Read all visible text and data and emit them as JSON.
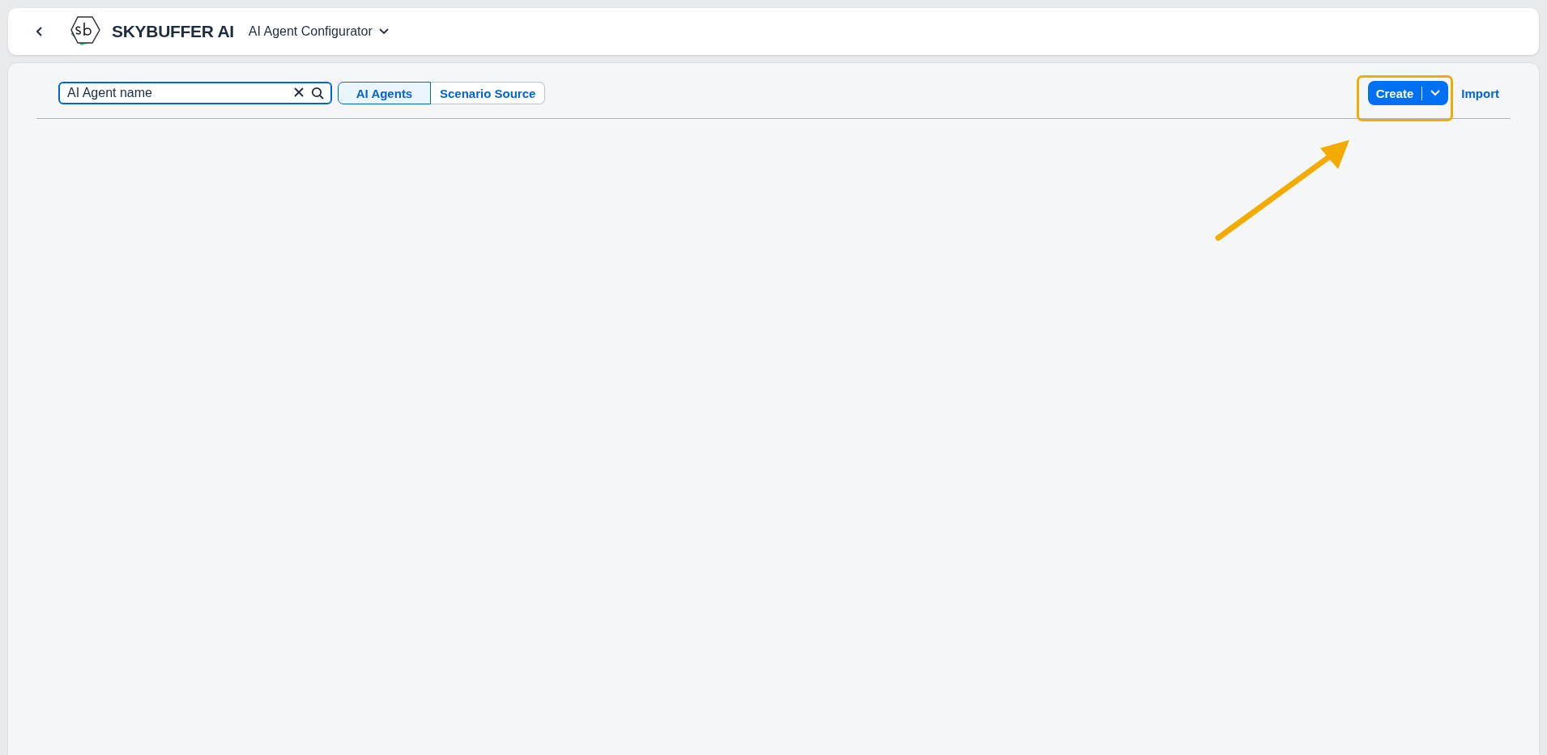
{
  "header": {
    "brand": "SKYBUFFER AI",
    "app_title": "AI Agent Configurator"
  },
  "toolbar": {
    "search": {
      "value": "AI Agent name"
    },
    "view_toggle": [
      {
        "label": "AI Agents",
        "selected": true
      },
      {
        "label": "Scenario Source",
        "selected": false
      }
    ],
    "create_button": {
      "label": "Create"
    },
    "import_link": {
      "label": "Import"
    }
  }
}
